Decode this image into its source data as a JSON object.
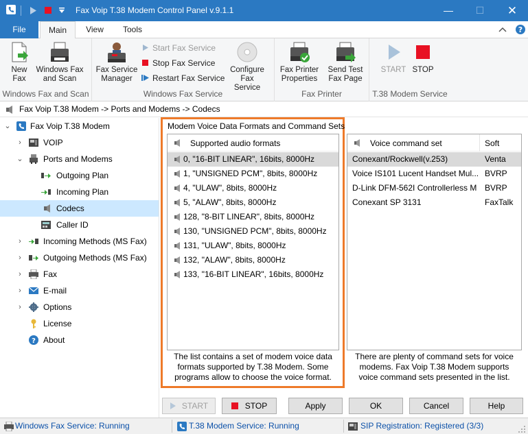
{
  "window": {
    "title": "Fax Voip T.38 Modem Control Panel v.9.1.1"
  },
  "ribbon_tabs": {
    "file": "File",
    "main": "Main",
    "view": "View",
    "tools": "Tools"
  },
  "ribbon": {
    "new_fax": [
      "New",
      "Fax"
    ],
    "windows_fax_scan": [
      "Windows Fax",
      "and Scan"
    ],
    "group_windows_fax_scan": "Windows Fax and Scan",
    "fax_service_manager": [
      "Fax Service",
      "Manager"
    ],
    "start_fax_service": "Start Fax Service",
    "stop_fax_service": "Stop Fax Service",
    "restart_fax_service": "Restart Fax Service",
    "configure_fax_service": [
      "Configure",
      "Fax Service"
    ],
    "group_windows_fax_service": "Windows Fax Service",
    "fax_printer_properties": [
      "Fax Printer",
      "Properties"
    ],
    "send_test_fax_page": [
      "Send Test",
      "Fax Page"
    ],
    "group_fax_printer": "Fax Printer",
    "start": "START",
    "stop": "STOP",
    "group_t38_modem_service": "T.38 Modem Service"
  },
  "breadcrumb": "Fax Voip T.38 Modem -> Ports and Modems -> Codecs",
  "tree": {
    "root": "Fax Voip T.38 Modem",
    "voip": "VOIP",
    "ports_and_modems": "Ports and Modems",
    "outgoing_plan": "Outgoing Plan",
    "incoming_plan": "Incoming Plan",
    "codecs": "Codecs",
    "caller_id": "Caller ID",
    "incoming_methods": "Incoming Methods (MS Fax)",
    "outgoing_methods": "Outgoing Methods (MS Fax)",
    "fax": "Fax",
    "email": "E-mail",
    "options": "Options",
    "license": "License",
    "about": "About"
  },
  "group_title": "Modem Voice Data Formats and Command Sets",
  "audio_formats": {
    "header": "Supported audio formats",
    "items": [
      "0, \"16-BIT LINEAR\", 16bits, 8000Hz",
      "1, \"UNSIGNED PCM\", 8bits, 8000Hz",
      "4, \"ULAW\", 8bits, 8000Hz",
      "5, \"ALAW\", 8bits, 8000Hz",
      "128, \"8-BIT LINEAR\", 8bits, 8000Hz",
      "130, \"UNSIGNED PCM\", 8bits, 8000Hz",
      "131, \"ULAW\", 8bits, 8000Hz",
      "132, \"ALAW\", 8bits, 8000Hz",
      "133, \"16-BIT LINEAR\", 16bits, 8000Hz"
    ],
    "description": [
      "The list contains a set of modem voice data",
      "formats supported by T.38 Modem. Some",
      "programs allow to choose the voice format."
    ]
  },
  "command_sets": {
    "header_name": "Voice command set",
    "header_soft": "Soft",
    "rows": [
      {
        "name": "Conexant/Rockwell(v.253)",
        "soft": "Venta"
      },
      {
        "name": "Voice IS101 Lucent Handset Mul...",
        "soft": "BVRP"
      },
      {
        "name": "D-Link DFM-562I Controllerless M",
        "soft": "BVRP"
      },
      {
        "name": "Conexant SP 3131",
        "soft": "FaxTalk"
      }
    ],
    "description": [
      "There are plenty of command sets for voice",
      "modems. Fax Voip T.38 Modem supports",
      "voice command sets presented in the list."
    ]
  },
  "buttons": {
    "start": "START",
    "stop": "STOP",
    "apply": "Apply",
    "ok": "OK",
    "cancel": "Cancel",
    "help": "Help"
  },
  "status": {
    "windows_fax": "Windows Fax Service: Running",
    "t38_modem": "T.38 Modem Service: Running",
    "sip": "SIP Registration: Registered (3/3)"
  },
  "colors": {
    "accent": "#2b79c2",
    "highlight_border": "#ee7a2a",
    "stop_red": "#e81123"
  }
}
